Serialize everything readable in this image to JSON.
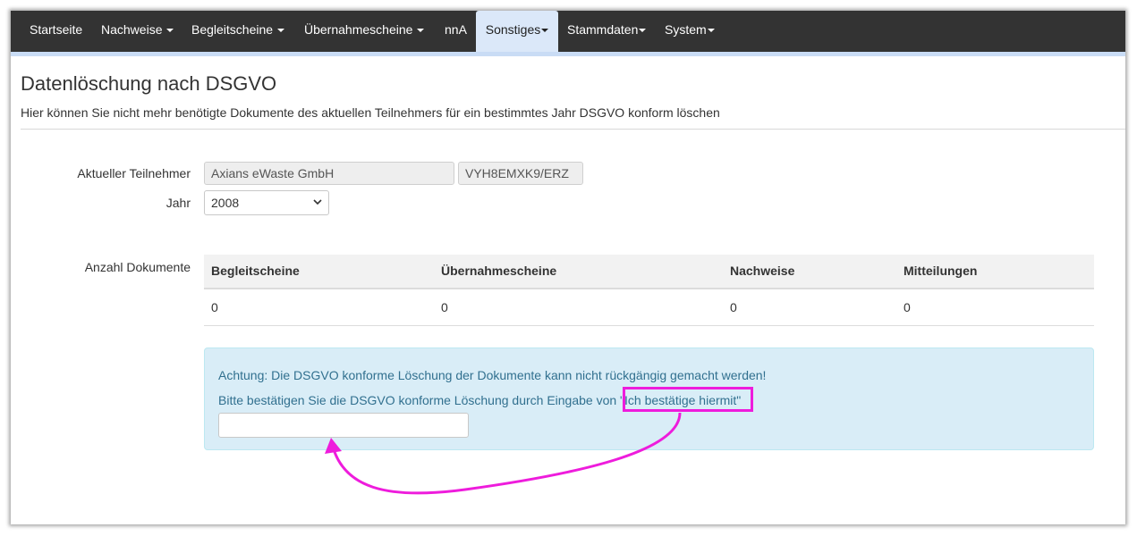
{
  "nav": {
    "items": [
      {
        "label": "Startseite",
        "dropdown": false,
        "active": false
      },
      {
        "label": "Nachweise",
        "dropdown": true,
        "active": false
      },
      {
        "label": "Begleitscheine",
        "dropdown": true,
        "active": false
      },
      {
        "label": "Übernahmescheine",
        "dropdown": true,
        "active": false
      },
      {
        "label": "nnA",
        "dropdown": false,
        "active": false
      },
      {
        "label": "Sonstiges",
        "dropdown": true,
        "active": true
      },
      {
        "label": "Stammdaten",
        "dropdown": true,
        "active": false
      },
      {
        "label": "System",
        "dropdown": true,
        "active": false
      }
    ]
  },
  "page": {
    "title": "Datenlöschung nach DSGVO",
    "subtitle": "Hier können Sie nicht mehr benötigte Dokumente des aktuellen Teilnehmers für ein bestimmtes Jahr DSGVO konform löschen"
  },
  "form": {
    "participant_label": "Aktueller Teilnehmer",
    "participant_name": "Axians eWaste GmbH",
    "participant_id": "VYH8EMXK9/ERZ",
    "year_label": "Jahr",
    "year_value": "2008",
    "documents_label": "Anzahl Dokumente"
  },
  "table": {
    "headers": [
      "Begleitscheine",
      "Übernahmescheine",
      "Nachweise",
      "Mitteilungen"
    ],
    "values": [
      "0",
      "0",
      "0",
      "0"
    ]
  },
  "alert": {
    "warning": "Achtung: Die DSGVO konforme Löschung der Dokumente kann nicht rückgängig gemacht werden!",
    "instruction": "Bitte bestätigen Sie die DSGVO konforme Löschung durch Eingabe von ",
    "phrase": "\"Ich bestätige hiermit\"",
    "input_value": ""
  },
  "colors": {
    "navbar": "#333333",
    "nav_active": "#dbe8f9",
    "alert_bg": "#d9edf7",
    "alert_text": "#31708f",
    "annotation": "#ee1cdc"
  }
}
